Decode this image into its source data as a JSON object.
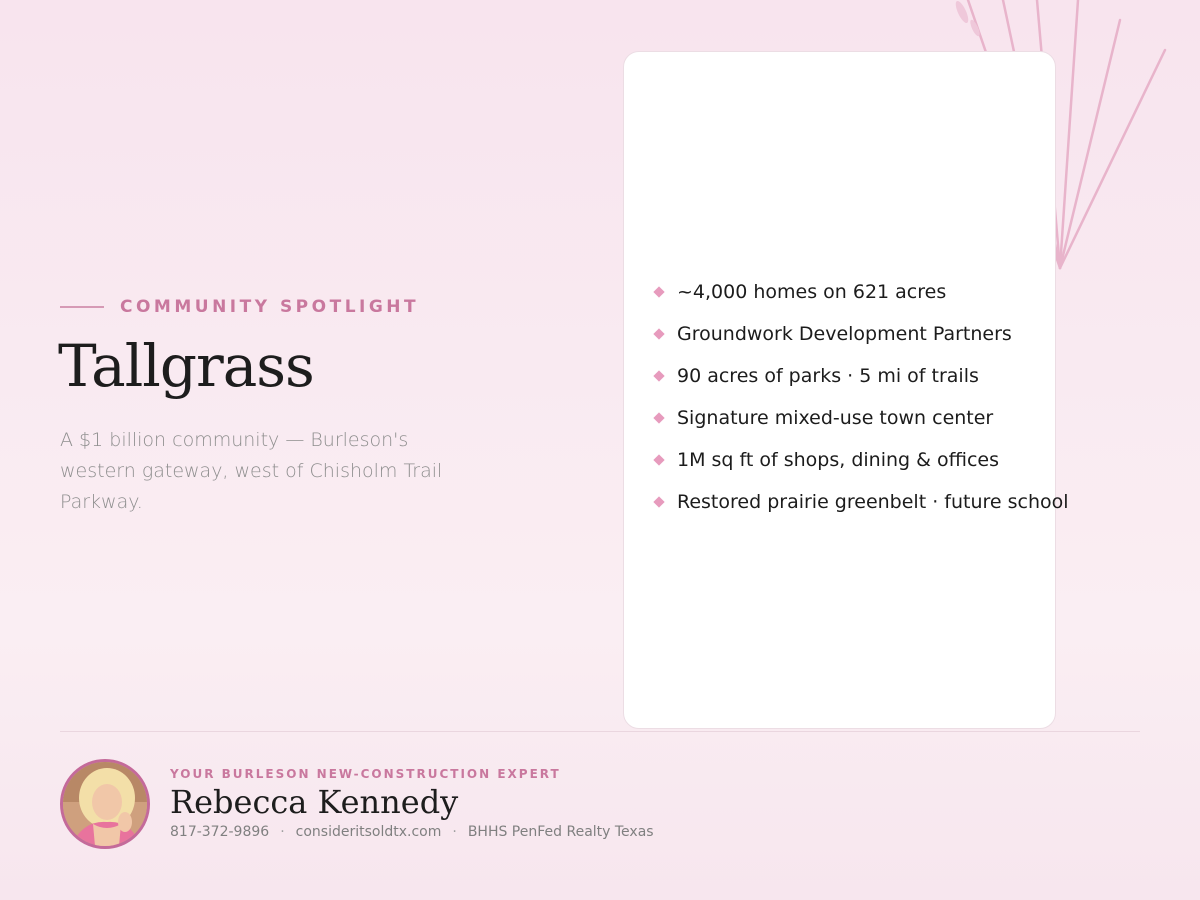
{
  "hero": {
    "eyebrow": "COMMUNITY SPOTLIGHT",
    "title": "Tallgrass",
    "subtitle": "A $1 billion community — Burleson's western gateway, west of Chisholm Trail Parkway."
  },
  "highlights": [
    "~4,000 homes on 621 acres",
    "Groundwork Development Partners",
    "90 acres of parks · 5 mi of trails",
    "Signature mixed-use town center",
    "1M sq ft of shops, dining & offices",
    "Restored prairie greenbelt · future school"
  ],
  "agent": {
    "tagline": "YOUR BURLESON NEW-CONSTRUCTION EXPERT",
    "name": "Rebecca Kennedy",
    "phone": "817-372-9896",
    "website": "consideritsoldtx.com",
    "brokerage": "BHHS PenFed Realty Texas",
    "separator": "·"
  },
  "colors": {
    "accent": "#c9789e",
    "diamond": "#e79bbd",
    "avatar_border": "#c46a9a"
  }
}
